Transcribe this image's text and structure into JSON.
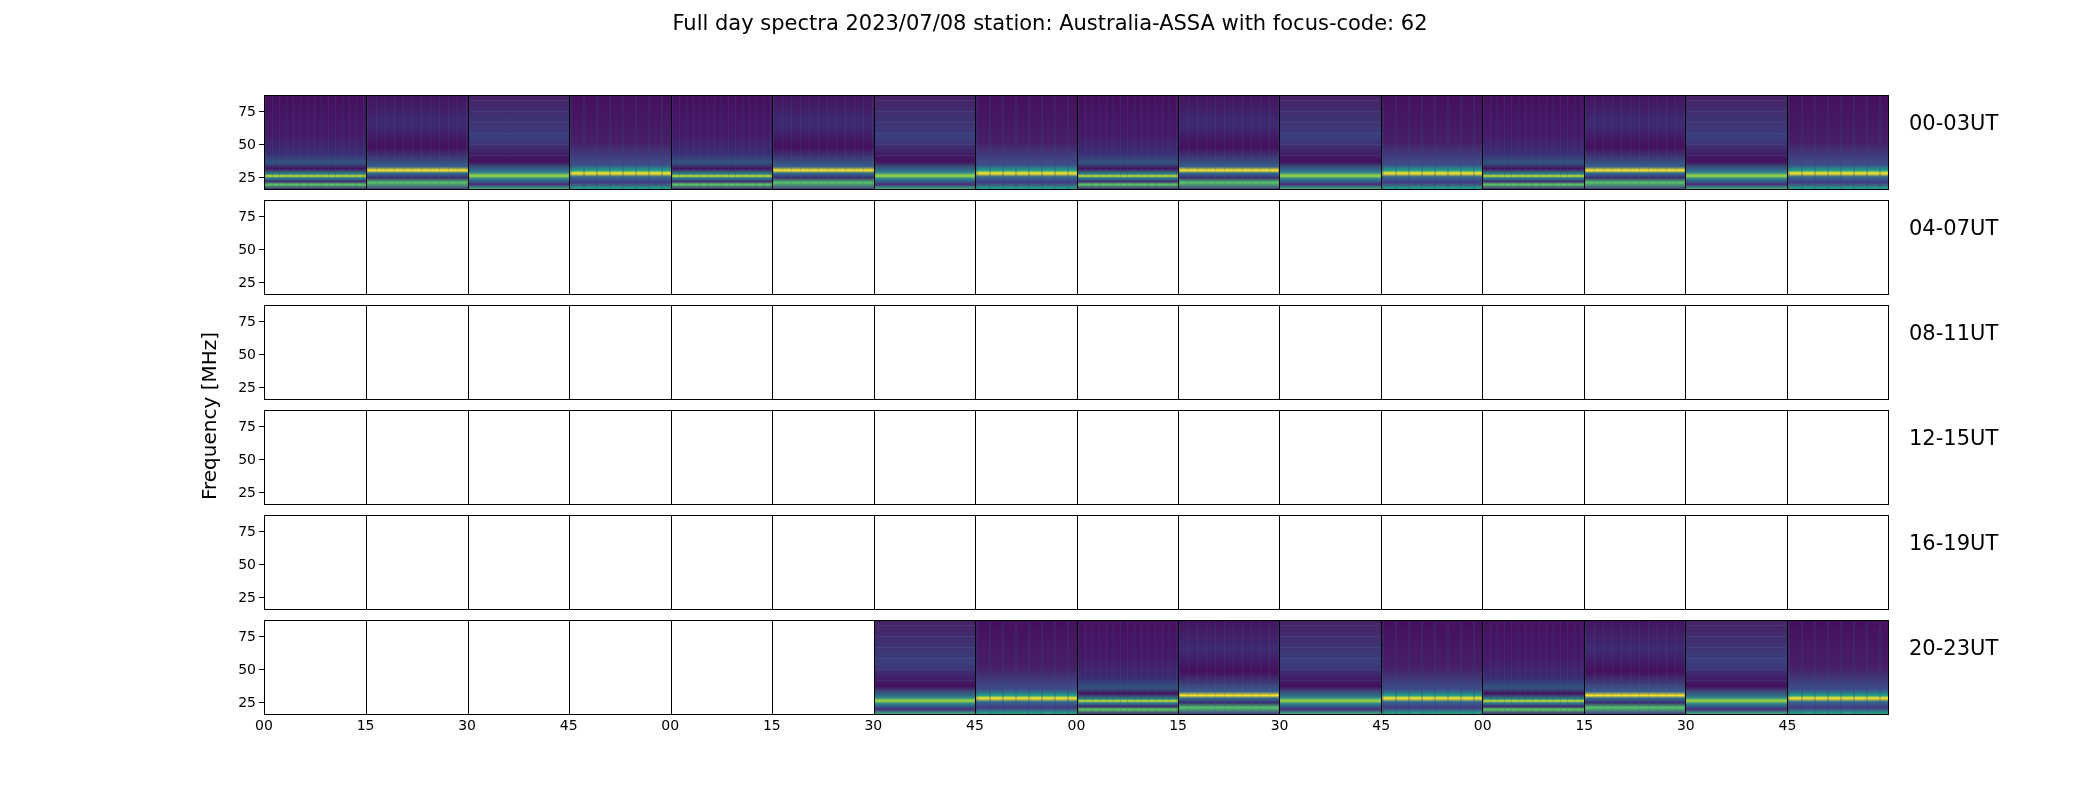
{
  "title": "Full day spectra 2023/07/08 station: Australia-ASSA with focus-code: 62",
  "ylabel": "Frequency [MHz]",
  "rows": [
    {
      "label": "00-03UT",
      "yticks": [
        "75",
        "50",
        "25"
      ],
      "cells": [
        {
          "kind": "spectrum"
        },
        {
          "kind": "spectrum"
        },
        {
          "kind": "spectrum"
        },
        {
          "kind": "spectrum"
        },
        {
          "kind": "spectrum"
        },
        {
          "kind": "spectrum"
        },
        {
          "kind": "spectrum"
        },
        {
          "kind": "spectrum"
        },
        {
          "kind": "spectrum"
        },
        {
          "kind": "spectrum"
        },
        {
          "kind": "spectrum"
        },
        {
          "kind": "spectrum"
        },
        {
          "kind": "spectrum"
        },
        {
          "kind": "spectrum"
        },
        {
          "kind": "spectrum"
        },
        {
          "kind": "spectrum"
        }
      ]
    },
    {
      "label": "04-07UT",
      "yticks": [
        "75",
        "50",
        "25"
      ],
      "cells": [
        {
          "kind": "empty"
        },
        {
          "kind": "empty"
        },
        {
          "kind": "empty"
        },
        {
          "kind": "empty"
        },
        {
          "kind": "empty"
        },
        {
          "kind": "empty"
        },
        {
          "kind": "empty"
        },
        {
          "kind": "empty"
        },
        {
          "kind": "empty"
        },
        {
          "kind": "empty"
        },
        {
          "kind": "empty"
        },
        {
          "kind": "empty"
        },
        {
          "kind": "empty"
        },
        {
          "kind": "empty"
        },
        {
          "kind": "empty"
        },
        {
          "kind": "empty"
        }
      ]
    },
    {
      "label": "08-11UT",
      "yticks": [
        "75",
        "50",
        "25"
      ],
      "cells": [
        {
          "kind": "empty"
        },
        {
          "kind": "empty"
        },
        {
          "kind": "empty"
        },
        {
          "kind": "empty"
        },
        {
          "kind": "empty"
        },
        {
          "kind": "empty"
        },
        {
          "kind": "empty"
        },
        {
          "kind": "empty"
        },
        {
          "kind": "empty"
        },
        {
          "kind": "empty"
        },
        {
          "kind": "empty"
        },
        {
          "kind": "empty"
        },
        {
          "kind": "empty"
        },
        {
          "kind": "empty"
        },
        {
          "kind": "empty"
        },
        {
          "kind": "empty"
        }
      ]
    },
    {
      "label": "12-15UT",
      "yticks": [
        "75",
        "50",
        "25"
      ],
      "cells": [
        {
          "kind": "empty"
        },
        {
          "kind": "empty"
        },
        {
          "kind": "empty"
        },
        {
          "kind": "empty"
        },
        {
          "kind": "empty"
        },
        {
          "kind": "empty"
        },
        {
          "kind": "empty"
        },
        {
          "kind": "empty"
        },
        {
          "kind": "empty"
        },
        {
          "kind": "empty"
        },
        {
          "kind": "empty"
        },
        {
          "kind": "empty"
        },
        {
          "kind": "empty"
        },
        {
          "kind": "empty"
        },
        {
          "kind": "empty"
        },
        {
          "kind": "empty"
        }
      ]
    },
    {
      "label": "16-19UT",
      "yticks": [
        "75",
        "50",
        "25"
      ],
      "cells": [
        {
          "kind": "empty"
        },
        {
          "kind": "empty"
        },
        {
          "kind": "empty"
        },
        {
          "kind": "empty"
        },
        {
          "kind": "empty"
        },
        {
          "kind": "empty"
        },
        {
          "kind": "empty"
        },
        {
          "kind": "empty"
        },
        {
          "kind": "empty"
        },
        {
          "kind": "empty"
        },
        {
          "kind": "empty"
        },
        {
          "kind": "empty"
        },
        {
          "kind": "empty"
        },
        {
          "kind": "empty"
        },
        {
          "kind": "empty"
        },
        {
          "kind": "empty"
        }
      ]
    },
    {
      "label": "20-23UT",
      "yticks": [
        "75",
        "50",
        "25"
      ],
      "cells": [
        {
          "kind": "empty"
        },
        {
          "kind": "empty"
        },
        {
          "kind": "empty"
        },
        {
          "kind": "empty"
        },
        {
          "kind": "empty"
        },
        {
          "kind": "empty"
        },
        {
          "kind": "spectrum"
        },
        {
          "kind": "spectrum"
        },
        {
          "kind": "spectrum"
        },
        {
          "kind": "spectrum"
        },
        {
          "kind": "spectrum"
        },
        {
          "kind": "spectrum"
        },
        {
          "kind": "spectrum"
        },
        {
          "kind": "spectrum"
        },
        {
          "kind": "spectrum"
        },
        {
          "kind": "spectrum"
        }
      ]
    }
  ],
  "xticks": [
    "00",
    "15",
    "30",
    "45",
    "00",
    "15",
    "30",
    "45",
    "00",
    "15",
    "30",
    "45",
    "00",
    "15",
    "30",
    "45"
  ]
}
